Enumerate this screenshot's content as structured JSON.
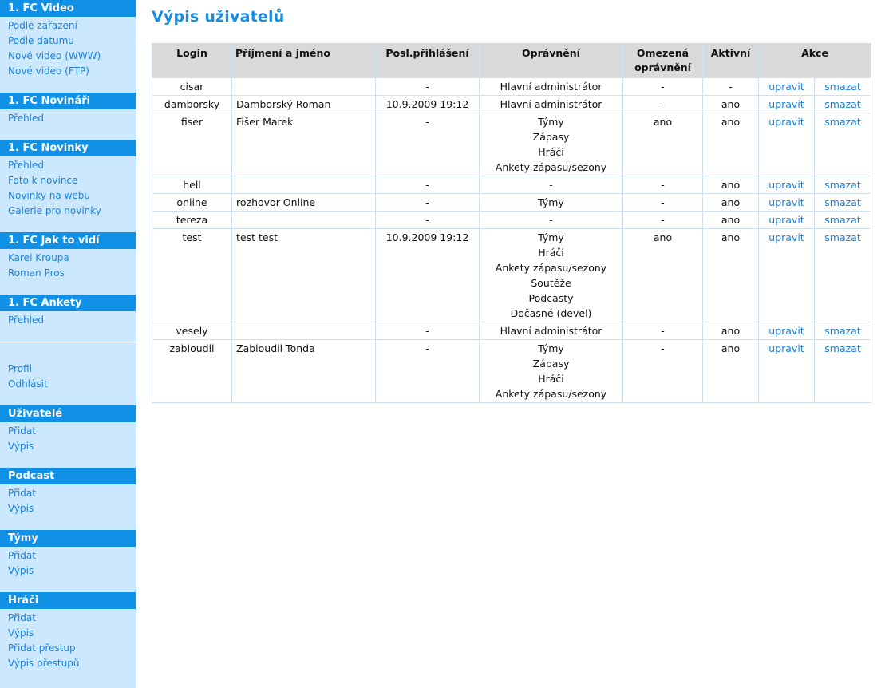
{
  "sidebar": {
    "sections": [
      {
        "title": "1. FC Video",
        "items": [
          "Podle zařazení",
          "Podle datumu",
          "Nové video (WWW)",
          "Nové video (FTP)"
        ]
      },
      {
        "title": "1. FC Novináři",
        "items": [
          "Přehled"
        ]
      },
      {
        "title": "1. FC Novinky",
        "items": [
          "Přehled",
          "Foto k novince",
          "Novinky na webu",
          "Galerie pro novinky"
        ]
      },
      {
        "title": "1. FC Jak to vidí",
        "items": [
          "Karel Kroupa",
          "Roman Pros"
        ]
      },
      {
        "title": "1. FC Ankety",
        "items": [
          "Přehled"
        ]
      },
      {
        "title": "",
        "items": [
          "Profil",
          "Odhlásit"
        ]
      },
      {
        "title": "Uživatelé",
        "items": [
          "Přidat",
          "Výpis"
        ]
      },
      {
        "title": "Podcast",
        "items": [
          "Přidat",
          "Výpis"
        ]
      },
      {
        "title": "Týmy",
        "items": [
          "Přidat",
          "Výpis"
        ]
      },
      {
        "title": "Hráči",
        "items": [
          "Přidat",
          "Výpis",
          "Přidat přestup",
          "Výpis přestupů"
        ]
      }
    ]
  },
  "main": {
    "title": "Výpis uživatelů",
    "table": {
      "columns": [
        "Login",
        "Příjmení a jméno",
        "Posl.přihlášení",
        "Oprávnění",
        "Omezená oprávnění",
        "Aktivní",
        "Akce"
      ],
      "edit_label": "upravit",
      "delete_label": "smazat",
      "rows": [
        {
          "login": "cisar",
          "name": "",
          "last_login": "-",
          "permissions": [
            "Hlavní administrátor"
          ],
          "restricted": "-",
          "active": "-"
        },
        {
          "login": "damborsky",
          "name": "Damborský Roman",
          "last_login": "10.9.2009 19:12",
          "permissions": [
            "Hlavní administrátor"
          ],
          "restricted": "-",
          "active": "ano"
        },
        {
          "login": "fiser",
          "name": "Fišer Marek",
          "last_login": "-",
          "permissions": [
            "Týmy",
            "Zápasy",
            "Hráči",
            "Ankety zápasu/sezony"
          ],
          "restricted": "ano",
          "active": "ano"
        },
        {
          "login": "hell",
          "name": "",
          "last_login": "-",
          "permissions": [
            "-"
          ],
          "restricted": "-",
          "active": "ano"
        },
        {
          "login": "online",
          "name": "rozhovor Online",
          "last_login": "-",
          "permissions": [
            "Týmy"
          ],
          "restricted": "-",
          "active": "ano"
        },
        {
          "login": "tereza",
          "name": "",
          "last_login": "-",
          "permissions": [
            "-"
          ],
          "restricted": "-",
          "active": "ano"
        },
        {
          "login": "test",
          "name": "test test",
          "last_login": "10.9.2009 19:12",
          "permissions": [
            "Týmy",
            "Hráči",
            "Ankety zápasu/sezony",
            "Soutěže",
            "Podcasty",
            "Dočasné (devel)"
          ],
          "restricted": "ano",
          "active": "ano"
        },
        {
          "login": "vesely",
          "name": "",
          "last_login": "-",
          "permissions": [
            "Hlavní administrátor"
          ],
          "restricted": "-",
          "active": "ano"
        },
        {
          "login": "zabloudil",
          "name": "Zabloudil Tonda",
          "last_login": "-",
          "permissions": [
            "Týmy",
            "Zápasy",
            "Hráči",
            "Ankety zápasu/sezony"
          ],
          "restricted": "-",
          "active": "ano"
        }
      ]
    }
  }
}
